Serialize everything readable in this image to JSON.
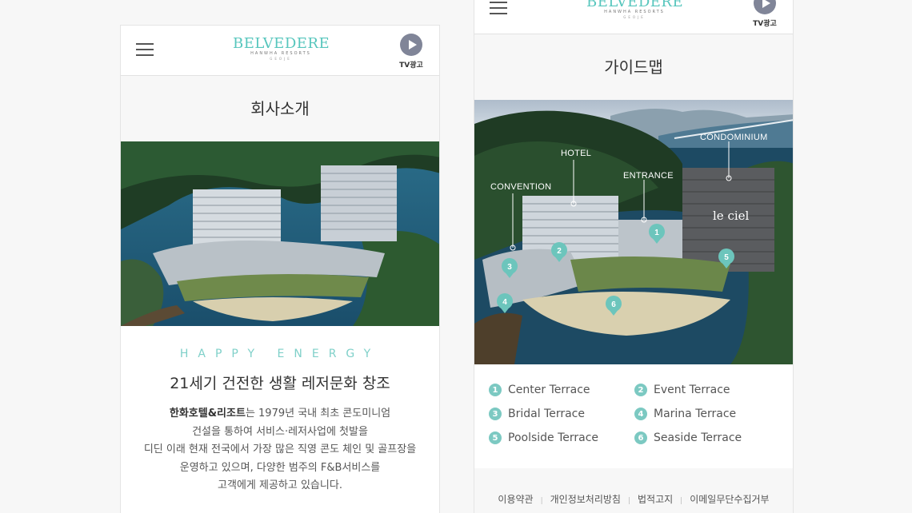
{
  "brand": {
    "logo_text": "BELVEDERE",
    "logo_sub": "HANWHA RESORTS",
    "logo_sub2": "GEOJE",
    "tv_label": "TV광고"
  },
  "left": {
    "section_title": "회사소개",
    "tagline": "HAPPY ENERGY",
    "headline": "21세기 건전한 생활 레저문화 창조",
    "company_name": "한화호텔&리조트",
    "desc_lines": [
      "는 1979년 국내 최초 콘도미니엄",
      "건설을 통하여 서비스·레저사업에 첫발을",
      "디딘 이래 현재 전국에서 가장 많은 직영 콘도 체인 및 골프장을",
      "운영하고 있으며, 다양한 범주의 F&B서비스를",
      "고객에게 제공하고 있습니다."
    ]
  },
  "right": {
    "section_title": "가이드맵",
    "map_labels": {
      "hotel": "HOTEL",
      "condominium": "CONDOMINIUM",
      "entrance": "ENTRANCE",
      "convention": "CONVENTION",
      "le_ciel": "le ciel"
    },
    "terraces": [
      {
        "num": "1",
        "label": "Center Terrace"
      },
      {
        "num": "2",
        "label": "Event Terrace"
      },
      {
        "num": "3",
        "label": "Bridal Terrace"
      },
      {
        "num": "4",
        "label": "Marina Terrace"
      },
      {
        "num": "5",
        "label": "Poolside Terrace"
      },
      {
        "num": "6",
        "label": "Seaside Terrace"
      }
    ],
    "footer_links": [
      "이용약관",
      "개인정보처리방침",
      "법적고지",
      "이메일무단수집거부"
    ]
  },
  "colors": {
    "accent": "#7cc9c2",
    "brand": "#57c6bd",
    "tv_button": "#808598"
  }
}
